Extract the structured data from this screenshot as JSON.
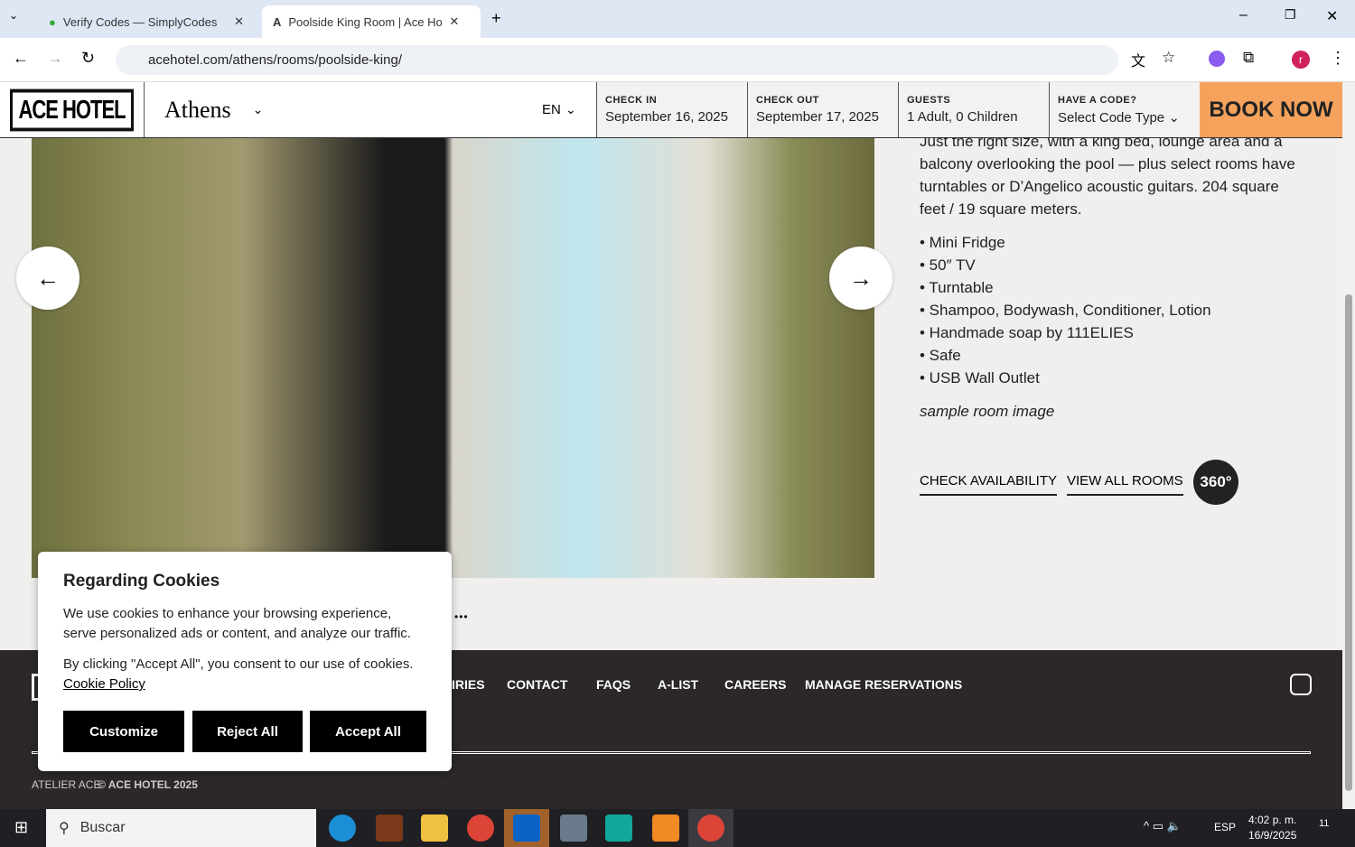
{
  "browser": {
    "tabs": [
      {
        "title": "Verify Codes — SimplyCodes"
      },
      {
        "title": "Poolside King Room | Ace Hotel"
      }
    ],
    "url": "acehotel.com/athens/rooms/poolside-king/"
  },
  "header": {
    "logo": "ACE HOTEL",
    "city": "Athens",
    "lang": "EN",
    "check_in_label": "CHECK IN",
    "check_in": "September 16, 2025",
    "check_out_label": "CHECK OUT",
    "check_out": "September 17, 2025",
    "guests_label": "GUESTS",
    "guests": "1 Adult, 0 Children",
    "code_label": "HAVE A CODE?",
    "code_value": "Select Code Type",
    "book": "BOOK NOW",
    "accent": "#f5a25d"
  },
  "room": {
    "description": "Just the right size, with a king bed, lounge area and a balcony overlooking the pool — plus select rooms have turntables or D’Angelico acoustic guitars. 204 square feet / 19 square meters.",
    "amenities": [
      "• Mini Fridge",
      "• 50″ TV",
      "• Turntable",
      "• Shampoo, Bodywash, Conditioner, Lotion",
      "• Handmade soap by 111ELIES",
      "• Safe",
      "• USB Wall Outlet"
    ],
    "caption": "sample room image",
    "check_availability": "CHECK AVAILABILITY",
    "view_all": "VIEW ALL ROOMS",
    "badge": "360°",
    "more": "•••"
  },
  "footer": {
    "links": [
      "IRIES",
      "CONTACT",
      "FAQS",
      "A-LIST",
      "CAREERS",
      "MANAGE RESERVATIONS"
    ],
    "atelier": "ATELIER ACE",
    "copyright": "© ACE HOTEL 2025"
  },
  "cookie": {
    "title": "Regarding Cookies",
    "body": "We use cookies to enhance your browsing experience, serve personalized ads or content, and analyze our traffic.",
    "consent": "By clicking \"Accept All\", you consent to our use of cookies.",
    "policy": "Cookie Policy",
    "customize": "Customize",
    "reject": "Reject All",
    "accept": "Accept All"
  },
  "taskbar": {
    "search": "Buscar",
    "lang": "ESP",
    "time": "4:02 p. m.",
    "date": "16/9/2025",
    "notif": "11"
  }
}
